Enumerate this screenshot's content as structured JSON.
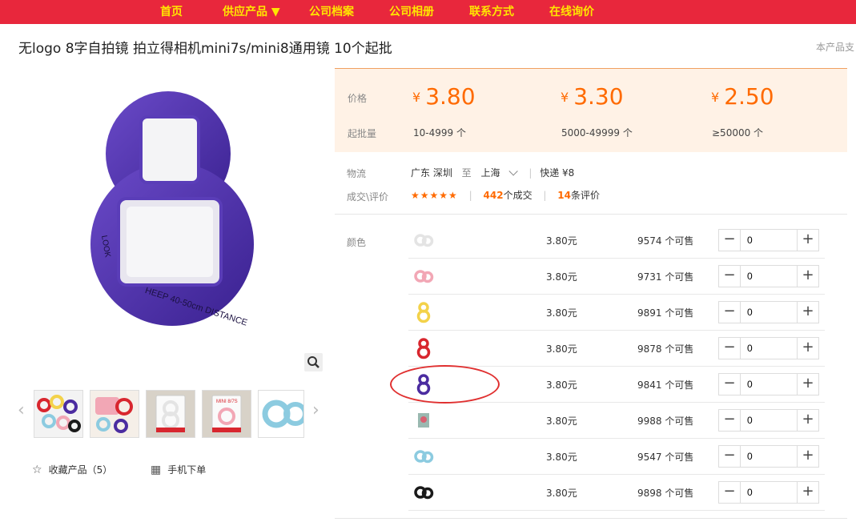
{
  "nav": {
    "items": [
      "首页",
      "供应产品 ▼",
      "公司档案",
      "公司相册",
      "联系方式",
      "在线询价"
    ]
  },
  "product": {
    "title": "无logo 8字自拍镜 拍立得相机mini7s/mini8通用镜 10个起批",
    "support_text": "本产品支"
  },
  "gallery": {
    "main_image_text": [
      "HEEP 40-50cm DISTANCE",
      "LOOK"
    ],
    "prev_arrow": "‹",
    "next_arrow": "›",
    "thumbs": [
      "thumb-1",
      "thumb-2",
      "thumb-3",
      "thumb-4",
      "thumb-5"
    ],
    "thumb_pack_text": "MINI 8/7S"
  },
  "actions": {
    "favorite_label": "收藏产品（5）",
    "mobile_order_label": "手机下单",
    "favorite_icon": "☆",
    "mobile_icon": "▦",
    "zoom_icon": "search-icon"
  },
  "pricing": {
    "price_label": "价格",
    "moq_label": "起批量",
    "currency": "¥",
    "tiers": [
      {
        "price": "3.80",
        "range": "10-4999 个"
      },
      {
        "price": "3.30",
        "range": "5000-49999 个"
      },
      {
        "price": "2.50",
        "range": "≥50000 个"
      }
    ]
  },
  "logistics": {
    "label": "物流",
    "from": "广东 深圳",
    "to_word": "至",
    "to": "上海",
    "method": "快递 ¥8"
  },
  "reviews": {
    "label": "成交\\评价",
    "stars": "★★★★★",
    "deals_num": "442",
    "deals_text": "个成交",
    "reviews_num": "14",
    "reviews_text": "条评价"
  },
  "colors": {
    "label": "颜色",
    "skus": [
      {
        "swatch": "#e4e4e4",
        "shape": "ring",
        "price": "3.80元",
        "stock": "9574 个可售",
        "qty": "0"
      },
      {
        "swatch": "#f2a7b5",
        "shape": "ring",
        "price": "3.80元",
        "stock": "9731 个可售",
        "qty": "0"
      },
      {
        "swatch": "#f3d24a",
        "shape": "eight",
        "price": "3.80元",
        "stock": "9891 个可售",
        "qty": "0"
      },
      {
        "swatch": "#d8262e",
        "shape": "eight",
        "price": "3.80元",
        "stock": "9878 个可售",
        "qty": "0"
      },
      {
        "swatch": "#4b2ca0",
        "shape": "eight",
        "price": "3.80元",
        "stock": "9841 个可售",
        "qty": "0"
      },
      {
        "swatch": "#d86070",
        "shape": "pack",
        "price": "3.80元",
        "stock": "9988 个可售",
        "qty": "0"
      },
      {
        "swatch": "#8ccbe0",
        "shape": "ring",
        "price": "3.80元",
        "stock": "9547 个可售",
        "qty": "0"
      },
      {
        "swatch": "#1a1a1a",
        "shape": "ring",
        "price": "3.80元",
        "stock": "9898 个可售",
        "qty": "0"
      }
    ]
  },
  "stepper": {
    "minus": "−",
    "plus": "+"
  }
}
